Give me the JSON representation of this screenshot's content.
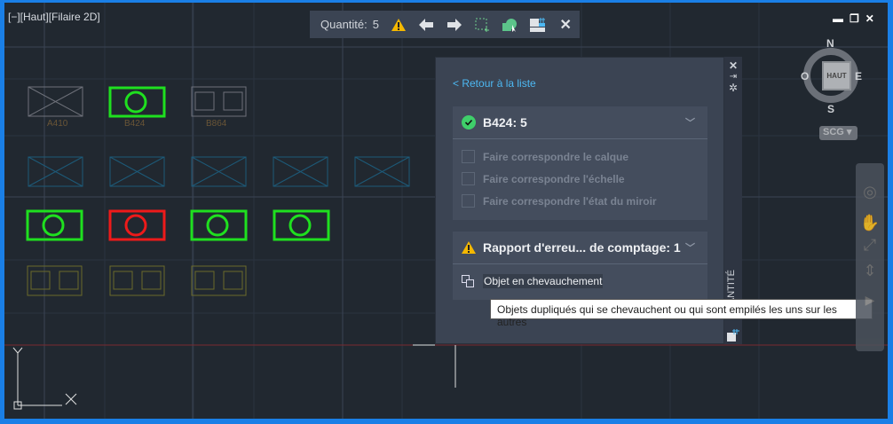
{
  "viewport": {
    "label": "[−][Haut][Filaire 2D]"
  },
  "toolbar": {
    "quantity_label": "Quantité:",
    "quantity_value": "5",
    "icons": [
      "warning-icon",
      "arrow-left-icon",
      "arrow-right-icon",
      "select-icon",
      "zoom-objects-icon",
      "count-table-icon",
      "close-icon"
    ]
  },
  "drawing": {
    "block_labels": [
      "A410",
      "B424",
      "B864"
    ]
  },
  "panel": {
    "back_link": "< Retour à la liste",
    "block_card": {
      "title": "B424: 5",
      "options": [
        "Faire correspondre le calque",
        "Faire correspondre l'échelle",
        "Faire correspondre l'état du miroir"
      ]
    },
    "error_card": {
      "title": "Rapport d'erreu... de comptage: 1",
      "items": [
        "Objet en chevauchement"
      ]
    },
    "side_title": "QUANTITÉ"
  },
  "tooltip": "Objets dupliqués qui se chevauchent ou qui sont empilés les uns sur les autres",
  "viewcube": {
    "n": "N",
    "s": "S",
    "e": "E",
    "w": "O",
    "face": "HAUT",
    "ucs": "SCG"
  },
  "colors": {
    "accent": "#1a7fe6",
    "ok": "#3fcf6a",
    "warn": "#f5b800",
    "link": "#4db8f2"
  }
}
